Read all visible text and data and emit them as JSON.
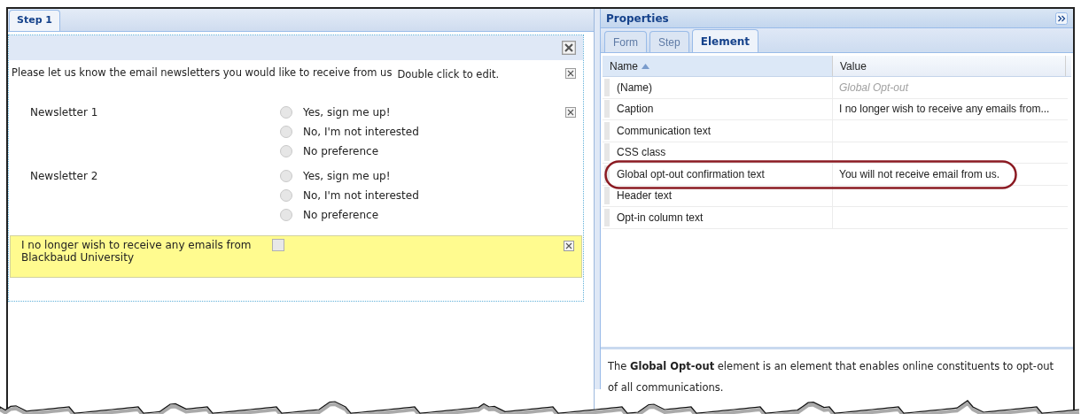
{
  "step_tabs": [
    {
      "label": "Step 1",
      "selected": true
    }
  ],
  "form": {
    "instruction": "Please let us know the email newsletters you would like to receive from us",
    "edit_hint": "Double click to edit.",
    "newsletters": [
      {
        "name": "Newsletter 1",
        "options": [
          {
            "label": "Yes, sign me up!",
            "selected": false
          },
          {
            "label": "No, I'm not interested",
            "selected": false
          },
          {
            "label": "No preference",
            "selected": false
          }
        ]
      },
      {
        "name": "Newsletter 2",
        "options": [
          {
            "label": "Yes, sign me up!",
            "selected": false
          },
          {
            "label": "No, I'm not interested",
            "selected": false
          },
          {
            "label": "No preference",
            "selected": false
          }
        ]
      }
    ],
    "opt_out": {
      "label": "I no longer wish to receive any emails from Blackbaud University",
      "checked": false
    }
  },
  "properties": {
    "title": "Properties",
    "tabs": [
      {
        "label": "Form",
        "selected": false
      },
      {
        "label": "Step",
        "selected": false
      },
      {
        "label": "Element",
        "selected": true
      }
    ],
    "columns": [
      {
        "label": "Name",
        "sorted": true
      },
      {
        "label": "Value",
        "sorted": false
      }
    ],
    "rows": [
      {
        "name": "(Name)",
        "value": "Global Opt-out",
        "readonly": true
      },
      {
        "name": "Caption",
        "value": "I no longer wish to receive any emails from...",
        "readonly": false
      },
      {
        "name": "Communication text"
      },
      {
        "name": "CSS class"
      },
      {
        "name": "Global opt-out confirmation text",
        "value": "You will not receive email from us.",
        "readonly": false,
        "highlighted": true
      },
      {
        "name": "Header text"
      },
      {
        "name": "Opt-in column text"
      }
    ],
    "description": "The **Global Opt-out** element is an element that enables online constituents to opt-out of all communications."
  }
}
